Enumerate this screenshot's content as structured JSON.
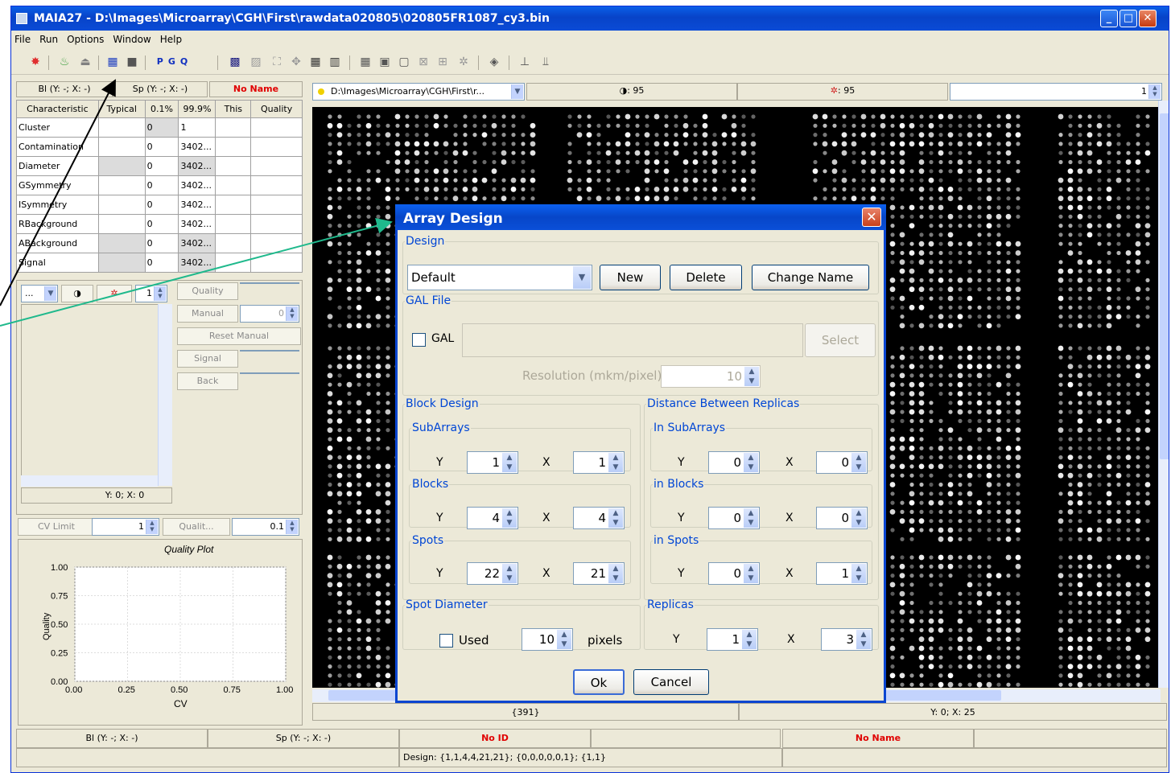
{
  "app": {
    "title": "MAIA27 - D:\\Images\\Microarray\\CGH\\First\\rawdata020805\\020805FR1087_cy3.bin",
    "window_buttons": [
      "minimize-icon",
      "maximize-icon",
      "close-icon"
    ]
  },
  "menu": [
    "File",
    "Run",
    "Options",
    "Window",
    "Help"
  ],
  "toolbar": {
    "pgq": [
      "P",
      "G",
      "Q"
    ]
  },
  "left": {
    "hdr_bl": "Bl (Y: -; X: -)",
    "hdr_sp": "Sp (Y: -; X: -)",
    "hdr_name": "No Name",
    "columns": [
      "Characteristic",
      "Typical",
      "0.1%",
      "99.9%",
      "This",
      "Quality"
    ],
    "rows": [
      {
        "name": "Cluster",
        "p01": "0",
        "p999": "1"
      },
      {
        "name": "Contamination",
        "p01": "0",
        "p999": "3402..."
      },
      {
        "name": "Diameter",
        "p01": "0",
        "p999": "3402..."
      },
      {
        "name": "GSymmetry",
        "p01": "0",
        "p999": "3402..."
      },
      {
        "name": "ISymmetry",
        "p01": "0",
        "p999": "3402..."
      },
      {
        "name": "RBackground",
        "p01": "0",
        "p999": "3402..."
      },
      {
        "name": "ABackground",
        "p01": "0",
        "p999": "3402..."
      },
      {
        "name": "Signal",
        "p01": "0",
        "p999": "3402..."
      }
    ],
    "ctrl_dots": "...",
    "ctrl_spin": "1",
    "quality_label": "Quality",
    "manual_label": "Manual",
    "manual_value": "0",
    "reset_manual": "Reset Manual",
    "signal_label": "Signal",
    "back_label": "Back",
    "coords": "Y: 0; X: 0",
    "cv_limit_label": "CV Limit",
    "cv_limit_value": "1",
    "qualit_label": "Qualit...",
    "qualit_value": "0.1"
  },
  "chart_data": {
    "type": "scatter",
    "title": "Quality Plot",
    "xlabel": "CV",
    "ylabel": "Quality",
    "xlim": [
      0,
      1
    ],
    "ylim": [
      0,
      1
    ],
    "xticks": [
      "0.00",
      "0.25",
      "0.50",
      "0.75",
      "1.00"
    ],
    "yticks": [
      "0.00",
      "0.25",
      "0.50",
      "0.75",
      "1.00"
    ],
    "series": []
  },
  "image_header": {
    "path": "D:\\Images\\Microarray\\CGH\\First\\r...",
    "contrast": ": 95",
    "brightness": ": 95",
    "zoom": "1"
  },
  "image_footer": {
    "count": "{391}",
    "coords": "Y: 0; X: 25"
  },
  "status": {
    "bl": "Bl (Y: -; X: -)",
    "sp": "Sp (Y: -; X: -)",
    "id": "No ID",
    "name": "No Name",
    "design": "Design: {1,1,4,4,21,21}; {0,0,0,0,0,1}; {1,1}"
  },
  "dialog": {
    "title": "Array Design",
    "design_legend": "Design",
    "design_value": "Default",
    "btn_new": "New",
    "btn_delete": "Delete",
    "btn_change_name": "Change Name",
    "gal_legend": "GAL File",
    "gal_label": "GAL",
    "select_label": "Select",
    "resolution_label": "Resolution (mkm/pixel)",
    "resolution_value": "10",
    "block_design_legend": "Block Design",
    "distance_legend": "Distance Between Replicas",
    "subarrays_legend": "SubArrays",
    "in_subarrays_legend": "In SubArrays",
    "blocks_legend": "Blocks",
    "in_blocks_legend": "in Blocks",
    "spots_legend": "Spots",
    "in_spots_legend": "in Spots",
    "y": "Y",
    "x": "X",
    "subarrays": {
      "y": "1",
      "x": "1"
    },
    "blocks": {
      "y": "4",
      "x": "4"
    },
    "spots": {
      "y": "22",
      "x": "21"
    },
    "in_subarrays": {
      "y": "0",
      "x": "0"
    },
    "in_blocks": {
      "y": "0",
      "x": "0"
    },
    "in_spots": {
      "y": "0",
      "x": "1"
    },
    "spot_diameter_legend": "Spot Diameter",
    "used_label": "Used",
    "diameter_value": "10",
    "pixels_label": "pixels",
    "replicas_legend": "Replicas",
    "replicas": {
      "y": "1",
      "x": "3"
    },
    "ok": "Ok",
    "cancel": "Cancel"
  },
  "colors": {
    "accent": "#0a46d0",
    "legend_blue": "#0046d5",
    "error_red": "#e00000",
    "arrow_green": "#1fb98c"
  }
}
